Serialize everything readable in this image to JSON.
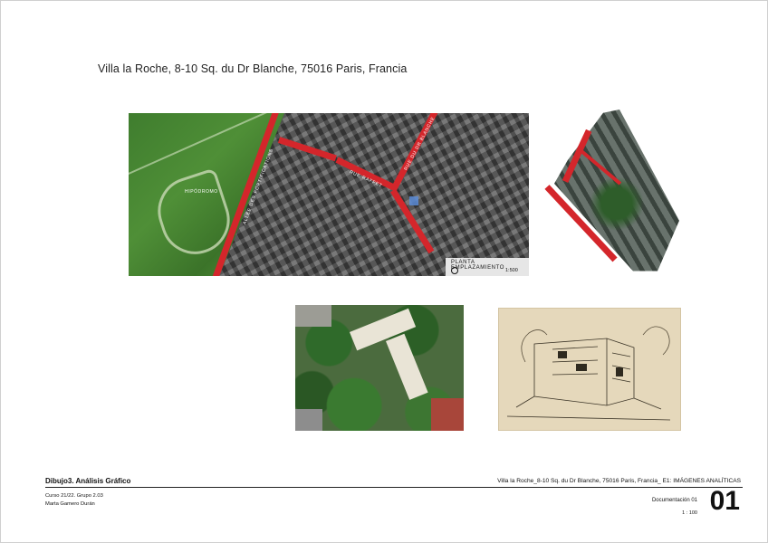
{
  "title": "Villa la Roche, 8-10 Sq. du Dr Blanche, 75016 Paris, Francia",
  "site_map": {
    "street_labels": [
      "ALLÉE DES FORTIFICATIONS",
      "RUE RAFFET",
      "RUE DU DR BLANCHE"
    ],
    "park_label": "HIPÓDROMO",
    "plan_label": "PLANTA EMPLAZAMIENTO",
    "scale": "1:500"
  },
  "footer": {
    "course": "Dibujo3. Análisis Gráfico",
    "project": "Villa la Roche_8-10 Sq. du Dr Blanche, 75016 Paris, Francia_ E1: IMÁGENES ANALÍTICAS",
    "group": "Curso 21/22. Grupo 2.03",
    "author": "Marta Gamero Durán",
    "doc_label": "Documentación 01",
    "scale": "1 : 100",
    "doc_number": "01"
  },
  "colors": {
    "street_red": "#d4262b",
    "park_green": "#4f8f37",
    "sketch_paper": "#e5d8bb"
  }
}
